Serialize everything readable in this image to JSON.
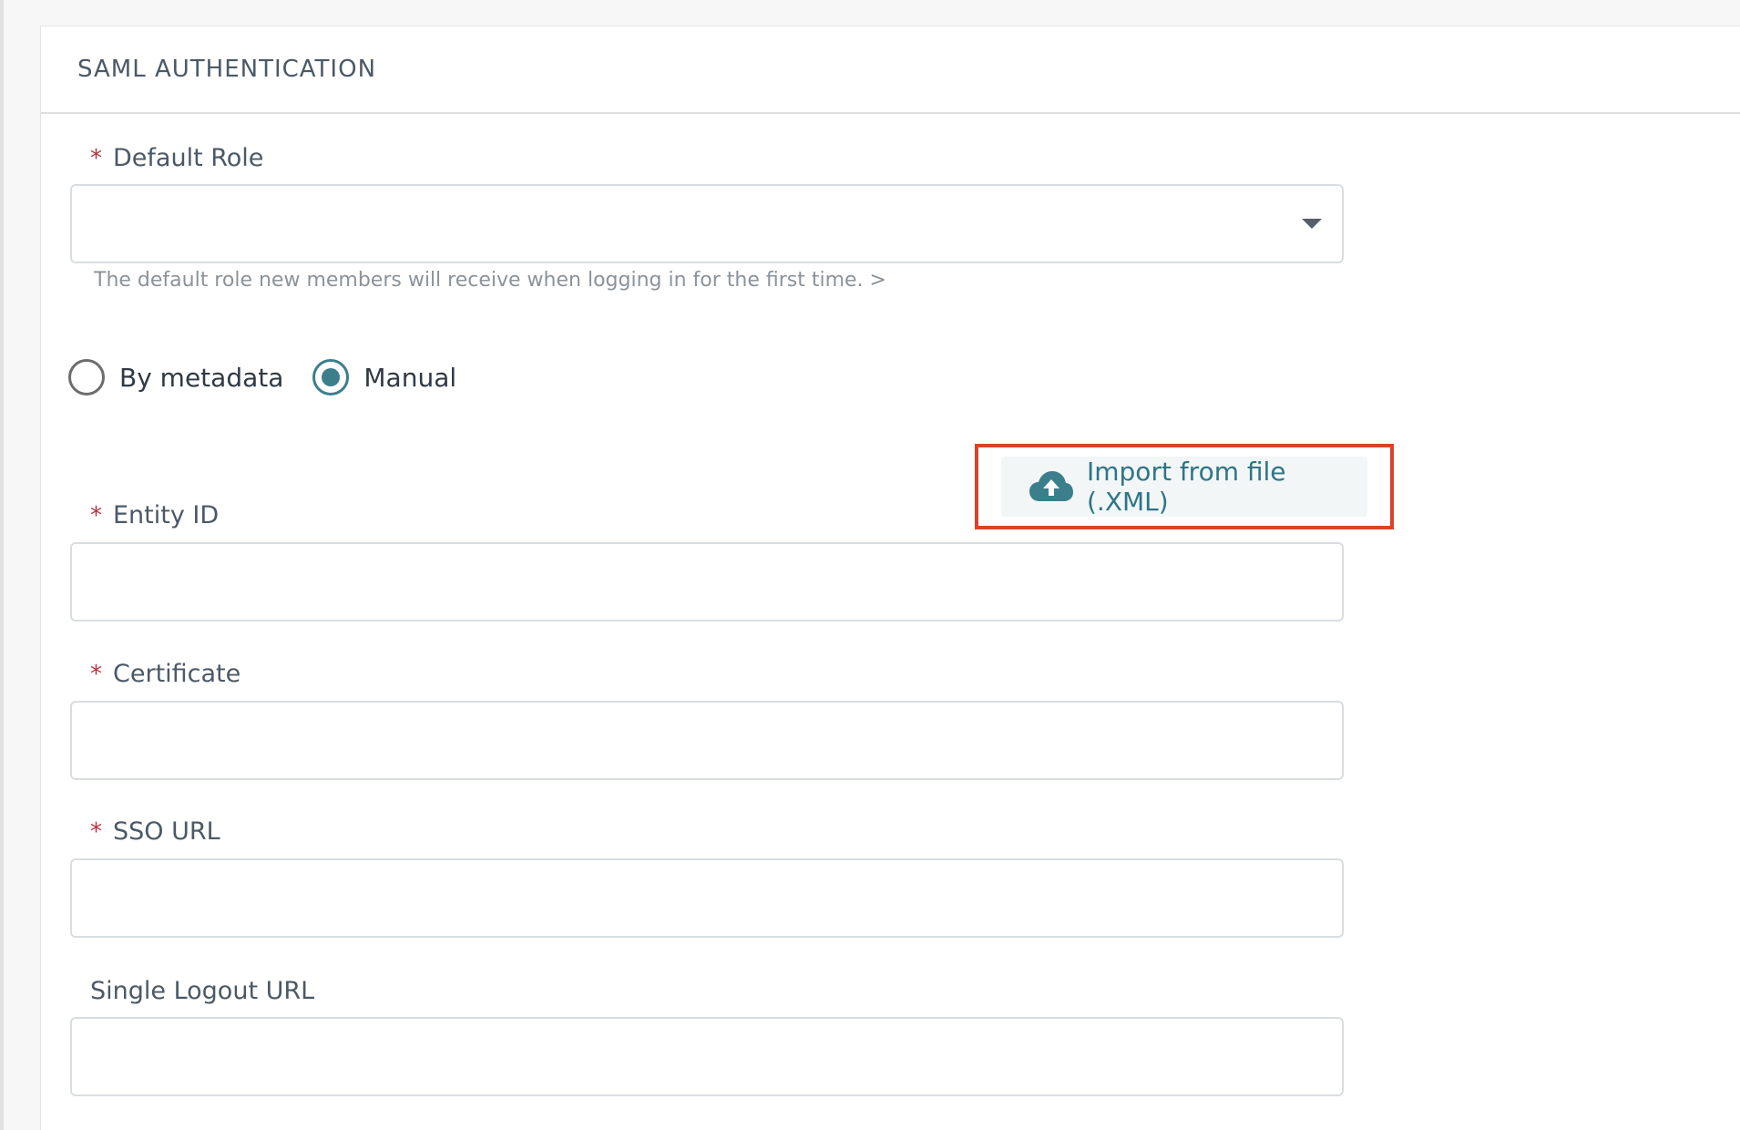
{
  "header": {
    "title": "SAML AUTHENTICATION"
  },
  "fields": {
    "default_role": {
      "label": "Default Role",
      "required": true,
      "value": "",
      "helper": "The default role new members will receive when logging in for the first time. >"
    },
    "entity_id": {
      "label": "Entity ID",
      "required": true,
      "value": ""
    },
    "certificate": {
      "label": "Certificate",
      "required": true,
      "value": ""
    },
    "sso_url": {
      "label": "SSO URL",
      "required": true,
      "value": ""
    },
    "single_logout_url": {
      "label": "Single Logout URL",
      "required": false,
      "value": ""
    }
  },
  "required_marker": "*",
  "config_mode": {
    "options": [
      {
        "label": "By metadata",
        "checked": false
      },
      {
        "label": "Manual",
        "checked": true
      }
    ]
  },
  "import_button": {
    "label": "Import from file (.XML)",
    "icon": "cloud-upload-icon"
  },
  "colors": {
    "accent": "#3c7f8c",
    "required": "#b8323f",
    "highlight": "#d9432c"
  }
}
